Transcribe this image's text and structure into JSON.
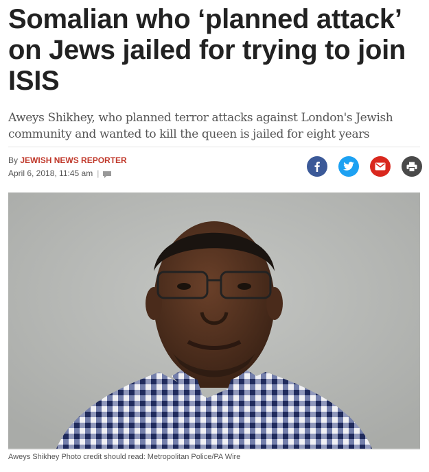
{
  "article": {
    "headline": "Somalian who ‘planned attack’ on Jews jailed for trying to join ISIS",
    "standfirst": "Aweys Shikhey, who planned terror attacks against London's Jewish community and wanted to kill the queen is jailed for eight years",
    "byline_prefix": "By",
    "author": "JEWISH NEWS REPORTER",
    "date": "April 6, 2018, 11:45 am",
    "separator": "|",
    "comment_icon": "comment-icon",
    "caption": "Aweys Shikhey Photo credit should read: Metropolitan Police/PA Wire"
  },
  "share": [
    {
      "name": "facebook",
      "icon": "facebook-icon",
      "color": "#3b5998"
    },
    {
      "name": "twitter",
      "icon": "twitter-icon",
      "color": "#1da1f2"
    },
    {
      "name": "email",
      "icon": "email-icon",
      "color": "#d9281e"
    },
    {
      "name": "print",
      "icon": "print-icon",
      "color": "#4a4a4a"
    }
  ],
  "colors": {
    "author": "#c0392b",
    "photo_background": "#b5b7b4"
  }
}
